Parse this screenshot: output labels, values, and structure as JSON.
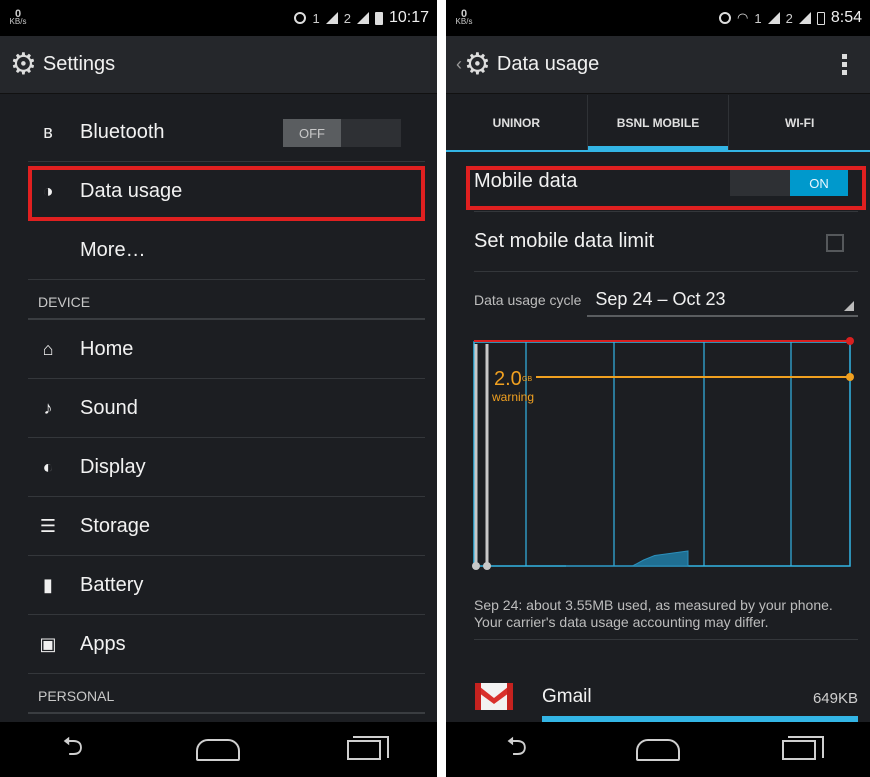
{
  "left": {
    "status": {
      "kbs_value": "0",
      "kbs_unit": "KB/s",
      "sim1": "1",
      "sim2": "2",
      "time": "10:17"
    },
    "actionbar": {
      "title": "Settings"
    },
    "items": [
      {
        "label": "Bluetooth",
        "icon": "bluetooth-icon",
        "toggle": "OFF"
      },
      {
        "label": "Data usage",
        "icon": "data-usage-icon"
      },
      {
        "label": "More…"
      }
    ],
    "device_header": "DEVICE",
    "device_items": [
      {
        "label": "Home",
        "icon": "home-icon"
      },
      {
        "label": "Sound",
        "icon": "sound-icon"
      },
      {
        "label": "Display",
        "icon": "display-icon"
      },
      {
        "label": "Storage",
        "icon": "storage-icon"
      },
      {
        "label": "Battery",
        "icon": "battery-icon"
      },
      {
        "label": "Apps",
        "icon": "apps-icon"
      }
    ],
    "personal_header": "PERSONAL"
  },
  "right": {
    "status": {
      "kbs_value": "0",
      "kbs_unit": "KB/s",
      "sim1": "1",
      "sim2": "2",
      "time": "8:54"
    },
    "actionbar": {
      "title": "Data usage"
    },
    "tabs": [
      "UNINOR",
      "BSNL MOBILE",
      "WI-FI"
    ],
    "active_tab": "BSNL MOBILE",
    "mobile_data": {
      "label": "Mobile data",
      "toggle": "ON"
    },
    "limit": {
      "label": "Set mobile data limit"
    },
    "cycle": {
      "label": "Data usage cycle",
      "value": "Sep 24 – Oct 23"
    },
    "chart": {
      "warning_value": "2.0",
      "warning_unit": "GB",
      "warning_label": "warning"
    },
    "note": "Sep 24: about 3.55MB used, as measured by your phone. Your carrier's data usage accounting may differ.",
    "app": {
      "name": "Gmail",
      "size": "649KB"
    }
  },
  "chart_data": {
    "type": "area",
    "title": "",
    "xlabel": "",
    "ylabel": "",
    "limit_line": "red",
    "warning_line": "orange",
    "series": [
      {
        "values": [
          0,
          0,
          0,
          0,
          0,
          0,
          0,
          0.2,
          0.35,
          0.4,
          0.45,
          0.5
        ]
      }
    ]
  },
  "colors": {
    "accent": "#33b5e5",
    "highlight": "#e02020",
    "warning": "#f0a020",
    "limit": "#d82020"
  }
}
